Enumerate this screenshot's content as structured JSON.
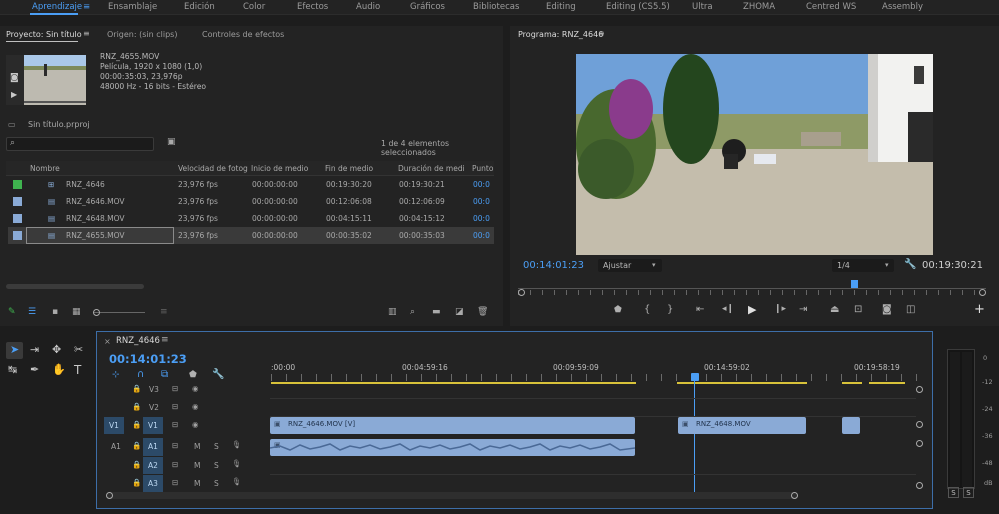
{
  "workspaces": [
    "Aprendizaje",
    "Ensamblaje",
    "Edición",
    "Color",
    "Efectos",
    "Audio",
    "Gráficos",
    "Bibliotecas",
    "Editing",
    "Editing (CS5.5)",
    "Ultra",
    "ZHOMA",
    "Centred WS",
    "Assembly"
  ],
  "project_panel": {
    "tabs": [
      "Proyecto: Sin título",
      "Origen: (sin clips)",
      "Controles de efectos"
    ],
    "preview": {
      "filename": "RNZ_4655.MOV",
      "line1": "Película, 1920 x 1080 (1,0)",
      "line2": "00:00:35:03, 23,976p",
      "line3": "48000 Hz - 16 bits - Estéreo"
    },
    "project_file": "Sin título.prproj",
    "search_placeholder": "",
    "selection_status": "1 de 4 elementos seleccionados",
    "columns": [
      "Nombre",
      "Velocidad de fotog",
      "Inicio de medio",
      "Fin de medio",
      "Duración de medi",
      "Punto"
    ],
    "rows": [
      {
        "name": "RNZ_4646",
        "fps": "23,976 fps",
        "start": "00:00:00:00",
        "end": "00:19:30:20",
        "duration": "00:19:30:21",
        "point": "00:0",
        "color": "#3fb34f"
      },
      {
        "name": "RNZ_4646.MOV",
        "fps": "23,976 fps",
        "start": "00:00:00:00",
        "end": "00:12:06:08",
        "duration": "00:12:06:09",
        "point": "00:0",
        "color": "#8aaad6"
      },
      {
        "name": "RNZ_4648.MOV",
        "fps": "23,976 fps",
        "start": "00:00:00:00",
        "end": "00:04:15:11",
        "duration": "00:04:15:12",
        "point": "00:0",
        "color": "#8aaad6"
      },
      {
        "name": "RNZ_4655.MOV",
        "fps": "23,976 fps",
        "start": "00:00:00:00",
        "end": "00:00:35:02",
        "duration": "00:00:35:03",
        "point": "00:0",
        "color": "#8aaad6"
      }
    ]
  },
  "program_monitor": {
    "tab": "Programa: RNZ_4646",
    "current_timecode": "00:14:01:23",
    "fit": "Ajustar",
    "resolution": "1/4",
    "duration_timecode": "00:19:30:21"
  },
  "timeline": {
    "tab": "RNZ_4646",
    "timecode": "00:14:01:23",
    "ruler_labels": [
      ":00:00",
      "00:04:59:16",
      "00:09:59:09",
      "00:14:59:02",
      "00:19:58:19"
    ],
    "video_tracks": [
      "V3",
      "V2",
      "V1"
    ],
    "audio_tracks": [
      "A1",
      "A2",
      "A3"
    ],
    "source_v": "V1",
    "source_a": "A1",
    "clips": [
      {
        "label": "RNZ_4646.MOV [V]"
      },
      {
        "label": "RNZ_4648.MOV"
      }
    ],
    "mute_label": "M",
    "solo_label": "S"
  },
  "meter": {
    "labels": [
      "0",
      "-12",
      "-24",
      "-36",
      "-48",
      "dB"
    ],
    "solo_buttons": [
      "S",
      "S"
    ]
  }
}
